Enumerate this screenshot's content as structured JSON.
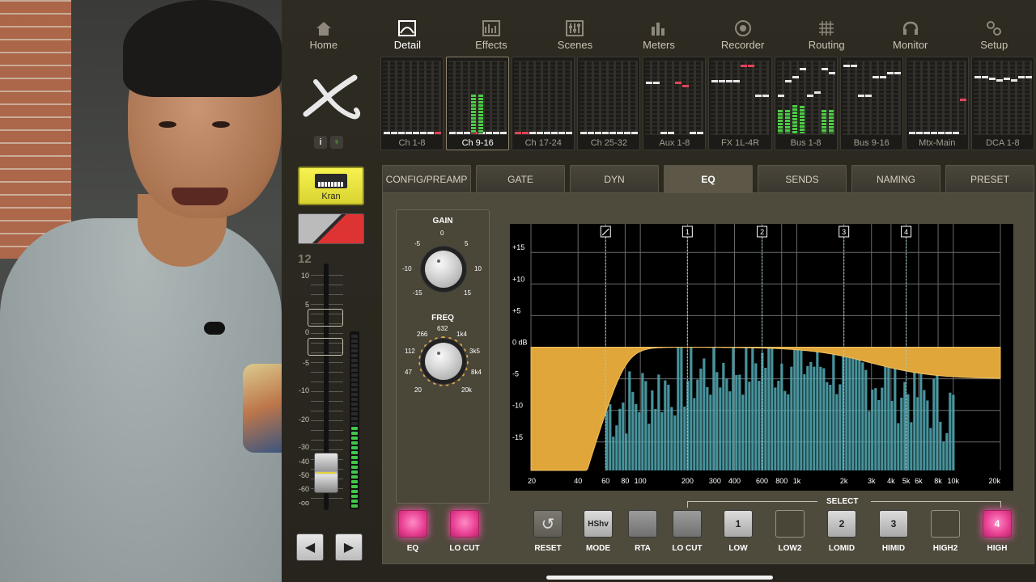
{
  "nav": [
    {
      "label": "Home",
      "icon": "home-icon",
      "active": false
    },
    {
      "label": "Detail",
      "icon": "detail-icon",
      "active": true
    },
    {
      "label": "Effects",
      "icon": "effects-icon",
      "active": false
    },
    {
      "label": "Scenes",
      "icon": "scenes-icon",
      "active": false
    },
    {
      "label": "Meters",
      "icon": "meters-icon",
      "active": false
    },
    {
      "label": "Recorder",
      "icon": "recorder-icon",
      "active": false
    },
    {
      "label": "Routing",
      "icon": "routing-icon",
      "active": false
    },
    {
      "label": "Monitor",
      "icon": "monitor-icon",
      "active": false
    },
    {
      "label": "Setup",
      "icon": "setup-icon",
      "active": false
    }
  ],
  "channel": {
    "info_label": "i",
    "name": "Kran",
    "number": "12",
    "fader_scale": [
      "10",
      "5",
      "0",
      "-5",
      "-10",
      "-20",
      "-30",
      "-40",
      "-50",
      "-60",
      "-oo"
    ],
    "prev_label": "◀",
    "next_label": "▶"
  },
  "banks": [
    "Ch 1-8",
    "Ch 9-16",
    "Ch 17-24",
    "Ch 25-32",
    "Aux 1-8",
    "FX 1L-4R",
    "Bus 1-8",
    "Bus 9-16",
    "Mtx-Main",
    "DCA 1-8"
  ],
  "active_bank": "Ch 9-16",
  "tabs": [
    "CONFIG/PREAMP",
    "GATE",
    "DYN",
    "EQ",
    "SENDS",
    "NAMING",
    "PRESET"
  ],
  "active_tab": "EQ",
  "gain_knob": {
    "title": "GAIN",
    "labels": [
      "0",
      "-5",
      "5",
      "-10",
      "10",
      "-15",
      "15"
    ]
  },
  "freq_knob": {
    "title": "FREQ",
    "labels": [
      "632",
      "266",
      "1k4",
      "112",
      "3k5",
      "47",
      "8k4",
      "20",
      "20k"
    ]
  },
  "eq_graph": {
    "db_labels": [
      "+15",
      "+10",
      "+5",
      "0 dB",
      "-5",
      "-10",
      "-15"
    ],
    "freq_labels": [
      "20",
      "40",
      "60",
      "80",
      "100",
      "200",
      "300",
      "400",
      "600",
      "800",
      "1k",
      "2k",
      "3k",
      "4k",
      "5k",
      "6k",
      "8k",
      "10k",
      "20k"
    ],
    "band_markers": [
      "1",
      "2",
      "3",
      "4"
    ],
    "curve_color": "#e0a63a",
    "rta_color": "#4fa3ad"
  },
  "bottom": {
    "eq_label": "EQ",
    "locut_label": "LO CUT",
    "reset_label": "RESET",
    "mode_label": "MODE",
    "mode_value": "HShv",
    "rta_label": "RTA",
    "locut2_label": "LO CUT",
    "low_label": "LOW",
    "low_value": "1",
    "low2_label": "LOW2",
    "lomid_label": "LOMID",
    "lomid_value": "2",
    "himid_label": "HIMID",
    "himid_value": "3",
    "high2_label": "HIGH2",
    "high_label": "HIGH",
    "high_value": "4",
    "select_label": "SELECT"
  }
}
